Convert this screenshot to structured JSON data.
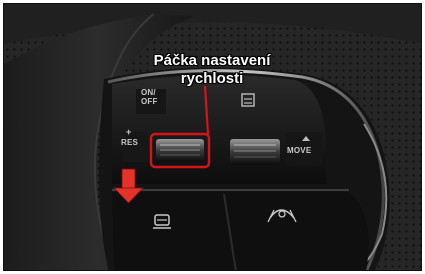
{
  "callout": {
    "line1": "Páčka nastavení",
    "line2": "rychlosti"
  },
  "labels": {
    "on_off": "ON/\nOFF",
    "res": "RES",
    "res_plus": "+",
    "move": "MOVE"
  },
  "colors": {
    "highlight": "#d3141c",
    "arrow": "#e4332a",
    "callout_text": "#ffffff"
  },
  "icons": [
    "distance-icon",
    "lkas-icon",
    "lane-assist-icon",
    "down-arrow-icon"
  ]
}
